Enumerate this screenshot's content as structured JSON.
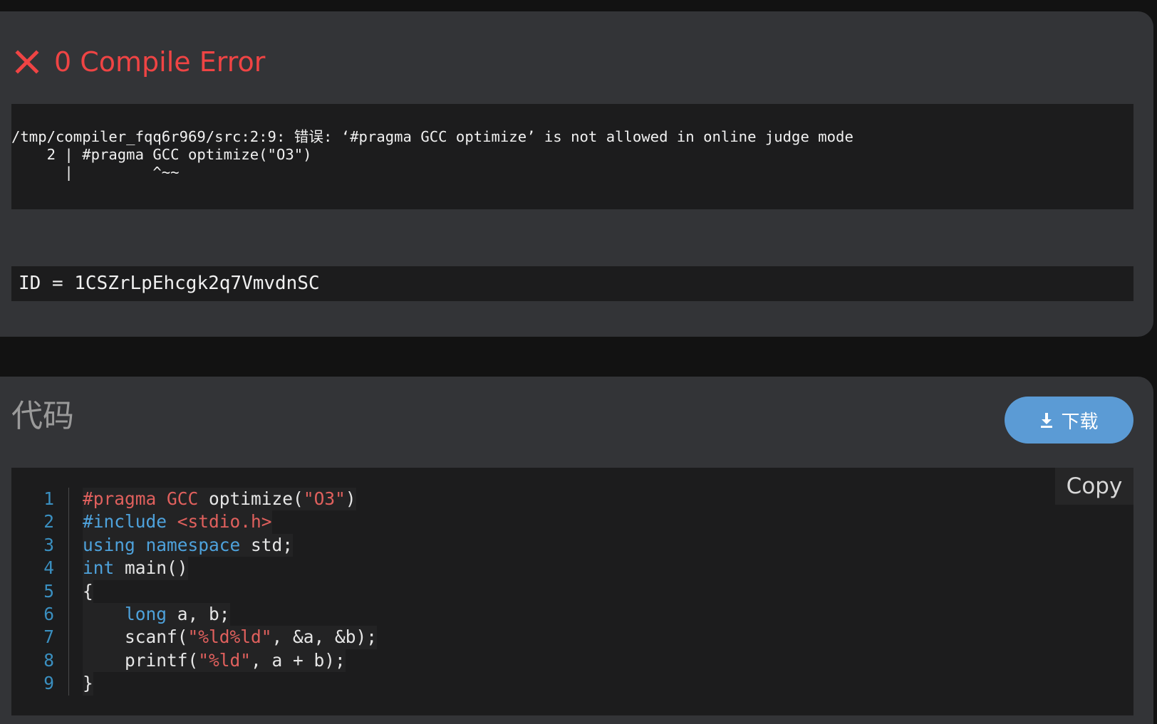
{
  "result": {
    "status_text": "0 Compile Error",
    "compile_output": "/tmp/compiler_fqq6r969/src:2:9: 错误: ‘#pragma GCC optimize’ is not allowed in online judge mode\n    2 | #pragma GCC optimize(\"O3\")\n      |         ^~~",
    "id_line": "ID = 1CSZrLpEhcgk2q7VmvdnSC"
  },
  "code_section": {
    "title": "代码",
    "download_label": "下载",
    "copy_label": "Copy",
    "lines": [
      {
        "n": "1",
        "tokens": [
          {
            "t": "#pragma",
            "c": "directive"
          },
          {
            "t": " ",
            "c": ""
          },
          {
            "t": "GCC",
            "c": "directive"
          },
          {
            "t": " optimize(",
            "c": ""
          },
          {
            "t": "\"O3\"",
            "c": "string"
          },
          {
            "t": ")",
            "c": ""
          }
        ]
      },
      {
        "n": "2",
        "tokens": [
          {
            "t": "#include",
            "c": "keyword"
          },
          {
            "t": " ",
            "c": ""
          },
          {
            "t": "<stdio.h>",
            "c": "string"
          }
        ]
      },
      {
        "n": "3",
        "tokens": [
          {
            "t": "using",
            "c": "keyword"
          },
          {
            "t": " ",
            "c": ""
          },
          {
            "t": "namespace",
            "c": "keyword"
          },
          {
            "t": " std;",
            "c": ""
          }
        ]
      },
      {
        "n": "4",
        "tokens": [
          {
            "t": "int",
            "c": "keyword"
          },
          {
            "t": " main()",
            "c": ""
          }
        ]
      },
      {
        "n": "5",
        "tokens": [
          {
            "t": "{",
            "c": ""
          }
        ]
      },
      {
        "n": "6",
        "tokens": [
          {
            "t": "    ",
            "c": ""
          },
          {
            "t": "long",
            "c": "keyword"
          },
          {
            "t": " a, b;",
            "c": ""
          }
        ]
      },
      {
        "n": "7",
        "tokens": [
          {
            "t": "    scanf(",
            "c": ""
          },
          {
            "t": "\"%ld%ld\"",
            "c": "string"
          },
          {
            "t": ", &a, &b);",
            "c": ""
          }
        ]
      },
      {
        "n": "8",
        "tokens": [
          {
            "t": "    printf(",
            "c": ""
          },
          {
            "t": "\"%ld\"",
            "c": "string"
          },
          {
            "t": ", a + b);",
            "c": ""
          }
        ]
      },
      {
        "n": "9",
        "tokens": [
          {
            "t": "}",
            "c": ""
          }
        ]
      }
    ]
  },
  "colors": {
    "error": "#ef4444",
    "accent": "#5b9bd5",
    "keyword": "#4ea2dc",
    "string": "#e0605d",
    "line_number": "#3a8fc0"
  },
  "icons": {
    "status": "close-icon",
    "download": "download-icon"
  }
}
